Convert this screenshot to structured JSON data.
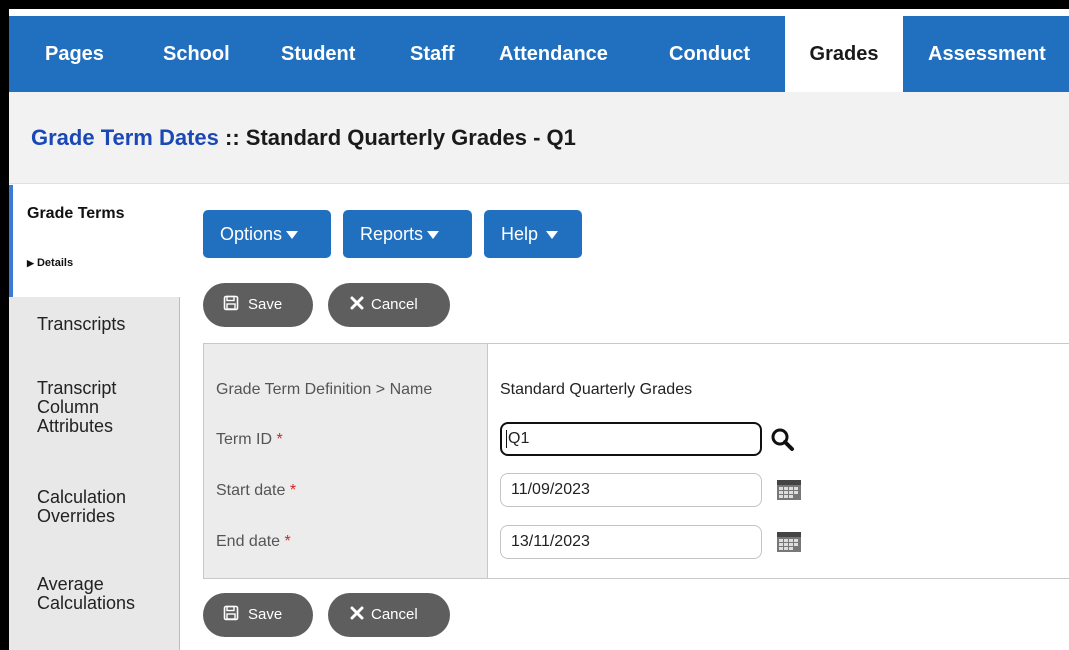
{
  "nav": {
    "tabs": [
      {
        "label": "Pages"
      },
      {
        "label": "School"
      },
      {
        "label": "Student"
      },
      {
        "label": "Staff"
      },
      {
        "label": "Attendance"
      },
      {
        "label": "Conduct"
      },
      {
        "label": "Grades",
        "active": true
      },
      {
        "label": "Assessment"
      }
    ]
  },
  "header": {
    "title_link": "Grade Term Dates",
    "title_rest": " :: Standard Quarterly Grades - Q1"
  },
  "sidebar": {
    "active": {
      "label": "Grade Terms",
      "sub": "Details",
      "sub_marker": "▶"
    },
    "items": [
      {
        "label": "Transcripts"
      },
      {
        "label": "Transcript Column Attributes"
      },
      {
        "label": "Calculation Overrides"
      },
      {
        "label": "Average Calculations"
      }
    ]
  },
  "toolbar": {
    "options_label": "Options",
    "reports_label": "Reports",
    "help_label": "Help",
    "save_label": "Save",
    "cancel_label": "Cancel"
  },
  "form": {
    "definition_label": "Grade Term Definition > Name",
    "definition_value": "Standard Quarterly Grades",
    "term_id_label": "Term ID",
    "term_id_value": "Q1",
    "start_date_label": "Start date",
    "start_date_value": "11/09/2023",
    "end_date_label": "End date",
    "end_date_value": "13/11/2023",
    "required_marker": "*"
  },
  "colors": {
    "nav_blue": "#2170c0",
    "title_link": "#1a48b5",
    "button_gray": "#5e5e5e",
    "required": "#dd2222"
  }
}
